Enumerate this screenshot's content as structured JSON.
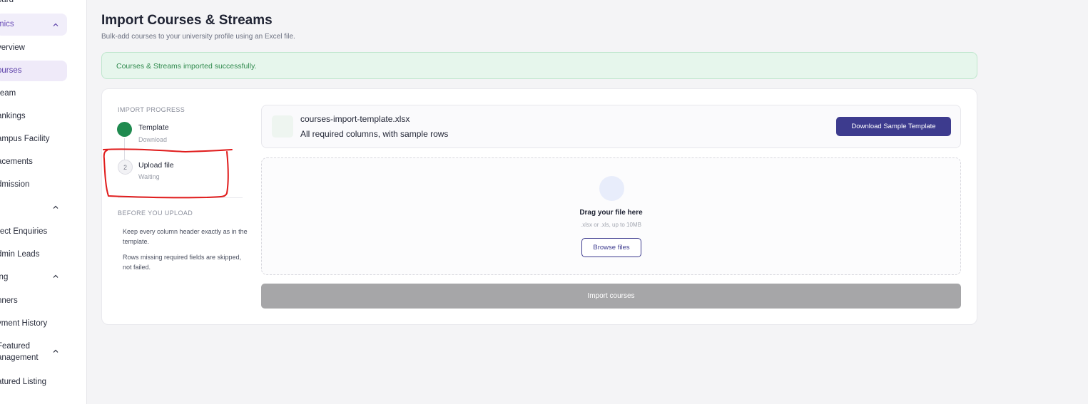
{
  "sidebar": {
    "items": [
      {
        "label": "oard"
      },
      {
        "label": "mics"
      },
      {
        "label": "verview"
      },
      {
        "label": "ourses"
      },
      {
        "label": "ream"
      },
      {
        "label": "ankings"
      },
      {
        "label": "ampus Facility"
      },
      {
        "label": "acements"
      },
      {
        "label": "dmission"
      },
      {
        "label": "rect Enquiries"
      },
      {
        "label": "dmin Leads"
      },
      {
        "label": "ing"
      },
      {
        "label": "nners"
      },
      {
        "label": "yment History"
      },
      {
        "label": "Featured"
      },
      {
        "label": "anagement"
      },
      {
        "label": "atured Listing"
      }
    ]
  },
  "header": {
    "title": "Import Courses & Streams",
    "subtitle": "Bulk-add courses to your university profile using an Excel file."
  },
  "alert": {
    "message": "Courses & Streams imported successfully."
  },
  "progress": {
    "caption": "IMPORT PROGRESS",
    "steps": [
      {
        "title": "Template",
        "status": "Download"
      },
      {
        "number": "2",
        "title": "Upload file",
        "status": "Waiting"
      }
    ]
  },
  "before_upload": {
    "caption": "BEFORE YOU UPLOAD",
    "tips": [
      "Keep every column header exactly as in the template.",
      "Rows missing required fields are skipped, not failed."
    ]
  },
  "template": {
    "file_name": "courses-import-template.xlsx",
    "description": "All required columns, with sample rows",
    "download_label": "Download Sample Template"
  },
  "dropzone": {
    "title": "Drag your file here",
    "hint": ".xlsx or .xls, up to 10MB",
    "browse_label": "Browse files"
  },
  "import_label": "Import courses",
  "colors": {
    "accent": "#3d3b8e",
    "success": "#1f8a4f",
    "alert_bg": "#e6f6ec",
    "annotation": "#e01b1b"
  }
}
